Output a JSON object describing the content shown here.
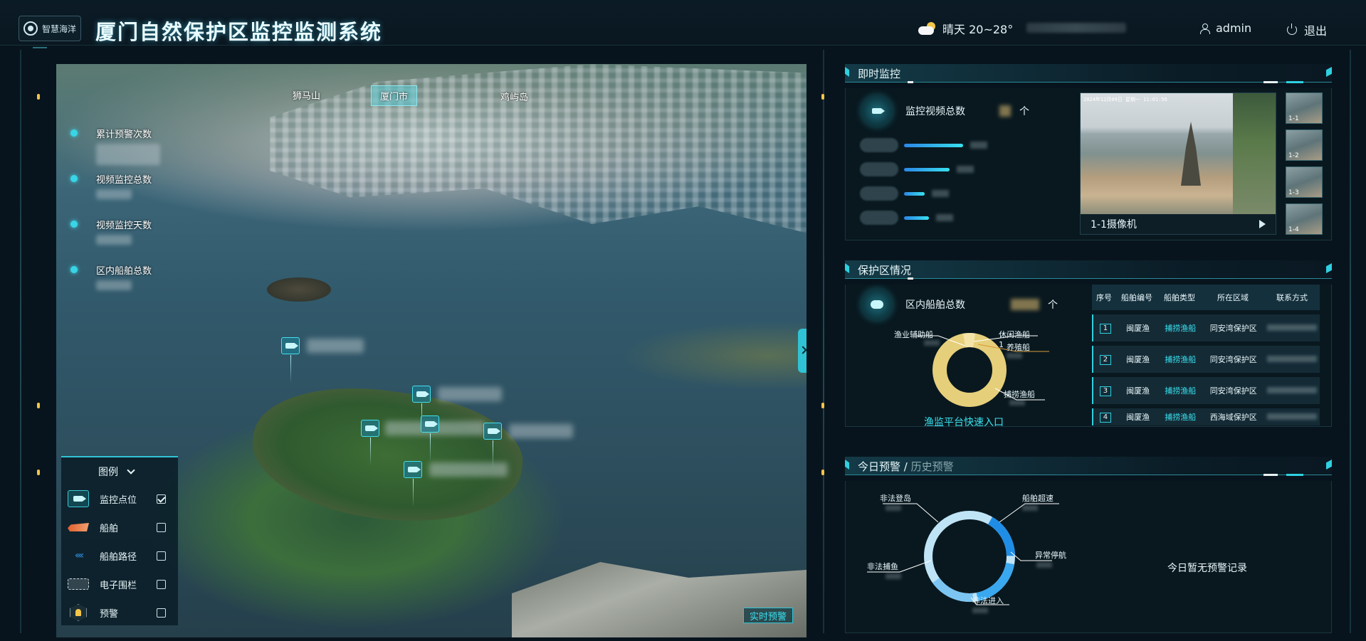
{
  "header": {
    "logo_text": "智慧海洋",
    "title": "厦门自然保护区监控监测系统",
    "weather": "晴天 20~28°",
    "username": "admin",
    "logout_label": "退出"
  },
  "map": {
    "places": [
      "狮马山",
      "厦门市",
      "鸡屿岛"
    ],
    "stats": [
      {
        "label": "累计预警次数"
      },
      {
        "label": "视频监控总数"
      },
      {
        "label": "视频监控天数"
      },
      {
        "label": "区内船舶总数"
      }
    ],
    "realtime_warning_button": "实时预警"
  },
  "legend": {
    "title": "图例",
    "items": [
      {
        "label": "监控点位",
        "icon": "camera-icon",
        "checked": true
      },
      {
        "label": "船舶",
        "icon": "ship-icon",
        "checked": false
      },
      {
        "label": "船舶路径",
        "icon": "route-icon",
        "checked": false
      },
      {
        "label": "电子围栏",
        "icon": "fence-icon",
        "checked": false
      },
      {
        "label": "预警",
        "icon": "alarm-icon",
        "checked": false
      }
    ]
  },
  "monitor_panel": {
    "title": "即时监控",
    "kpi_label": "监控视频总数",
    "kpi_unit": "个",
    "bars": [
      0.52,
      0.4,
      0.18,
      0.22
    ],
    "video_timestamp": "2024年12月09日 星期一 11:01:56",
    "video_caption": "1-1摄像机",
    "thumbs": [
      "1-1",
      "1-2",
      "1-3",
      "1-4"
    ]
  },
  "reserve_panel": {
    "title": "保护区情况",
    "kpi_label": "区内船舶总数",
    "kpi_unit": "个",
    "donut_labels": [
      "渔业辅助船",
      "休闲渔船",
      "养殖船",
      "捕捞渔船"
    ],
    "donut_number": "1",
    "entry_link": "渔监平台快速入口",
    "table": {
      "headers": [
        "序号",
        "船舶编号",
        "船舶类型",
        "所在区域",
        "联系方式"
      ],
      "rows": [
        {
          "idx": "1",
          "code": "闽厦渔",
          "type": "捕捞渔船",
          "area": "同安湾保护区"
        },
        {
          "idx": "2",
          "code": "闽厦渔",
          "type": "捕捞渔船",
          "area": "同安湾保护区"
        },
        {
          "idx": "3",
          "code": "闽厦渔",
          "type": "捕捞渔船",
          "area": "同安湾保护区"
        },
        {
          "idx": "4",
          "code": "闽厦渔",
          "type": "捕捞渔船",
          "area": "西海域保护区"
        }
      ]
    }
  },
  "warning_panel": {
    "title_today": "今日预警",
    "title_sep": "/",
    "title_history": "历史预警",
    "donut_labels": [
      "非法登岛",
      "船舶超速",
      "异常停航",
      "非法进入",
      "非法捕鱼"
    ],
    "empty_text": "今日暂无预警记录"
  },
  "colors": {
    "accent_cyan": "#2fd0e0",
    "donut_yellow": "#e6cf7a",
    "donut_blue": "#1f8de6"
  }
}
